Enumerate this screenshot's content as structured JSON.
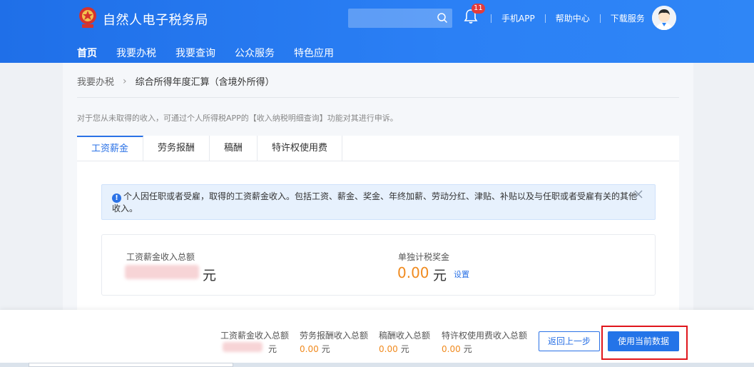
{
  "header": {
    "brand": "自然人电子税务局",
    "search_placeholder": "",
    "notification_count": "11",
    "links": [
      "手机APP",
      "帮助中心",
      "下载服务"
    ]
  },
  "nav": {
    "items": [
      "首页",
      "我要办税",
      "我要查询",
      "公众服务",
      "特色应用"
    ],
    "active": 0
  },
  "breadcrumb": {
    "parent": "我要办税",
    "current": "综合所得年度汇算（含境外所得）"
  },
  "notice": "对于您从未取得的收入，可通过个人所得税APP的【收入纳税明细查询】功能对其进行申诉。",
  "tabs": [
    "工资薪金",
    "劳务报酬",
    "稿酬",
    "特许权使用费"
  ],
  "active_tab": 0,
  "alert": {
    "text": "个人因任职或者受雇，取得的工资薪金收入。包括工资、薪金、奖金、年终加薪、劳动分红、津贴、补贴以及与任职或者受雇有关的其他收入。"
  },
  "summary": {
    "salary_label": "工资薪金收入总额",
    "salary_unit": "元",
    "bonus_label": "单独计税奖金",
    "bonus_value": "0.00",
    "bonus_unit": "元",
    "bonus_link": "设置"
  },
  "bottom": {
    "items": [
      {
        "label": "工资薪金收入总额",
        "value": "",
        "unit": "元"
      },
      {
        "label": "劳务报酬收入总额",
        "value": "0.00",
        "unit": "元"
      },
      {
        "label": "稿酬收入总额",
        "value": "0.00",
        "unit": "元"
      },
      {
        "label": "特许权使用费收入总额",
        "value": "0.00",
        "unit": "元"
      }
    ],
    "back_label": "返回上一步",
    "use_label": "使用当前数据"
  },
  "colors": {
    "header_blue": "#2b80f5",
    "accent": "#2b72e6",
    "amount_orange": "#f08a1e",
    "highlight_red": "#e0161c"
  }
}
